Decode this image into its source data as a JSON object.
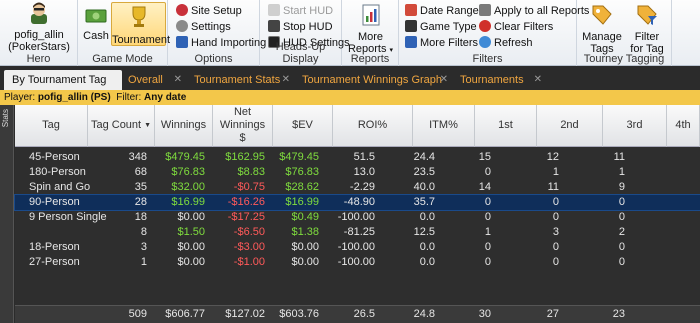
{
  "ribbon": {
    "hero": {
      "player": "pofig_allin",
      "site": "(PokerStars)",
      "label": "Hero"
    },
    "game_mode": {
      "cash": "Cash",
      "tournament": "Tournament",
      "label": "Game Mode"
    },
    "options": {
      "site_setup": "Site Setup",
      "settings": "Settings",
      "hand_importing": "Hand Importing",
      "label": "Options"
    },
    "hud": {
      "start": "Start HUD",
      "stop": "Stop HUD",
      "settings": "HUD Settings",
      "label": "Heads-Up Display"
    },
    "reports": {
      "more_line1": "More",
      "more_line2": "Reports",
      "label": "Reports"
    },
    "filters": {
      "date_range": "Date Range",
      "game_type": "Game Type",
      "more_filters": "More Filters",
      "apply_all": "Apply to all Reports",
      "clear": "Clear Filters",
      "refresh": "Refresh",
      "label": "Filters"
    },
    "tourney": {
      "manage_line1": "Manage",
      "manage_line2": "Tags",
      "filter_line1": "Filter",
      "filter_line2": "for Tag",
      "label": "Tourney Tagging"
    }
  },
  "tabs": [
    "By Tournament Tag",
    "Overall",
    "Tournament Stats",
    "Tournament Winnings Graph",
    "Tournaments"
  ],
  "filterline": {
    "player_label": "Player:",
    "player_value": "pofig_allin (PS)",
    "filter_label": "Filter:",
    "filter_value": "Any date"
  },
  "side_label": "Stats",
  "columns": [
    {
      "label": "Tag"
    },
    {
      "label": "Tag Count",
      "sort": "▼"
    },
    {
      "label": "Winnings"
    },
    {
      "label": "Net Winnings $"
    },
    {
      "label": "$EV"
    },
    {
      "label": "ROI%"
    },
    {
      "label": "ITM%"
    },
    {
      "label": "1st"
    },
    {
      "label": "2nd"
    },
    {
      "label": "3rd"
    },
    {
      "label": "4th"
    }
  ],
  "rows": [
    {
      "tag": "45-Person",
      "count": "348",
      "win": "$479.45",
      "net": "$162.95",
      "ev": "$479.45",
      "roi": "51.5",
      "itm": "24.4",
      "p1": "15",
      "p2": "12",
      "p3": "11",
      "win_c": "green",
      "net_c": "green",
      "ev_c": "green"
    },
    {
      "tag": "180-Person",
      "count": "68",
      "win": "$76.83",
      "net": "$8.83",
      "ev": "$76.83",
      "roi": "13.0",
      "itm": "23.5",
      "p1": "0",
      "p2": "1",
      "p3": "1",
      "win_c": "green",
      "net_c": "green",
      "ev_c": "green"
    },
    {
      "tag": "Spin and Go",
      "count": "35",
      "win": "$32.00",
      "net": "-$0.75",
      "ev": "$28.62",
      "roi": "-2.29",
      "itm": "40.0",
      "p1": "14",
      "p2": "11",
      "p3": "9",
      "win_c": "green",
      "net_c": "red",
      "ev_c": "green"
    },
    {
      "tag": "90-Person",
      "count": "28",
      "win": "$16.99",
      "net": "-$16.26",
      "ev": "$16.99",
      "roi": "-48.90",
      "itm": "35.7",
      "p1": "0",
      "p2": "0",
      "p3": "0",
      "win_c": "green",
      "net_c": "red",
      "ev_c": "green",
      "selected": true
    },
    {
      "tag": "9 Person Single",
      "count": "18",
      "win": "$0.00",
      "net": "-$17.25",
      "ev": "$0.49",
      "roi": "-100.00",
      "itm": "0.0",
      "p1": "0",
      "p2": "0",
      "p3": "0",
      "win_c": "",
      "net_c": "red",
      "ev_c": "green"
    },
    {
      "tag": "",
      "count": "8",
      "win": "$1.50",
      "net": "-$6.50",
      "ev": "$1.38",
      "roi": "-81.25",
      "itm": "12.5",
      "p1": "1",
      "p2": "3",
      "p3": "2",
      "win_c": "green",
      "net_c": "red",
      "ev_c": "green"
    },
    {
      "tag": "18-Person",
      "count": "3",
      "win": "$0.00",
      "net": "-$3.00",
      "ev": "$0.00",
      "roi": "-100.00",
      "itm": "0.0",
      "p1": "0",
      "p2": "0",
      "p3": "0",
      "win_c": "",
      "net_c": "red",
      "ev_c": ""
    },
    {
      "tag": "27-Person",
      "count": "1",
      "win": "$0.00",
      "net": "-$1.00",
      "ev": "$0.00",
      "roi": "-100.00",
      "itm": "0.0",
      "p1": "0",
      "p2": "0",
      "p3": "0",
      "win_c": "",
      "net_c": "red",
      "ev_c": ""
    }
  ],
  "totals": {
    "count": "509",
    "win": "$606.77",
    "net": "$127.02",
    "ev": "$603.76",
    "roi": "26.5",
    "itm": "24.8",
    "p1": "30",
    "p2": "27",
    "p3": "23"
  },
  "colors": {
    "positive": "#7fdc3e",
    "negative": "#ff5a5a",
    "tab_inactive": "#f0a640",
    "filter_bar": "#f3c74a",
    "selection": "#0f2e5a"
  }
}
